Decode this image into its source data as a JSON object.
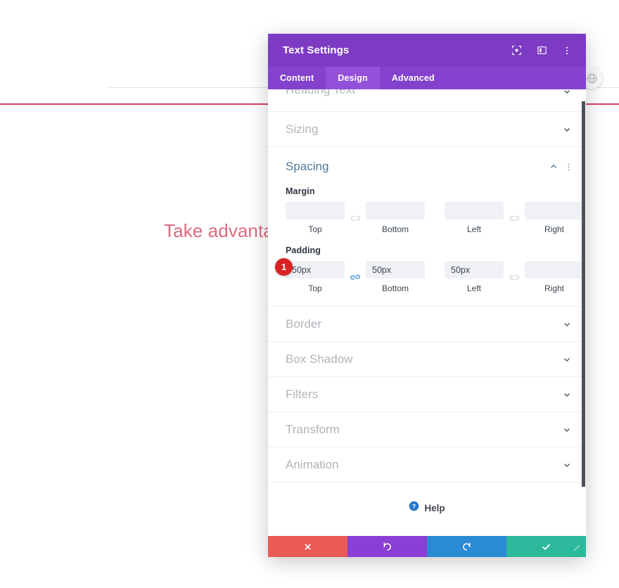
{
  "background": {
    "headline": "Take advantage",
    "headline_color": "#dd6b7f",
    "divider_gray_color": "#e2e2e6",
    "divider_red_color": "#d6405f",
    "edge_toggle_icon": "globe-disabled-icon"
  },
  "modal": {
    "title": "Text Settings",
    "header_color": "#7d3bc4",
    "header_icons": [
      {
        "name": "focus-target-icon",
        "label": "Focus"
      },
      {
        "name": "panel-layout-icon",
        "label": "Layout"
      },
      {
        "name": "more-options-icon",
        "label": "More"
      }
    ],
    "tabs": [
      {
        "label": "Content",
        "active": false
      },
      {
        "label": "Design",
        "active": true
      },
      {
        "label": "Advanced",
        "active": false
      }
    ],
    "accordions_top": [
      {
        "label": "Heading Text",
        "state": "collapsed"
      },
      {
        "label": "Sizing",
        "state": "collapsed"
      }
    ],
    "spacing": {
      "title": "Spacing",
      "title_color": "#4e7a9c",
      "state": "expanded",
      "margin": {
        "label": "Margin",
        "link_state": "unlinked",
        "fields": [
          {
            "caption": "Top",
            "value": ""
          },
          {
            "caption": "Bottom",
            "value": ""
          },
          {
            "caption": "Left",
            "value": ""
          },
          {
            "caption": "Right",
            "value": ""
          }
        ]
      },
      "padding": {
        "label": "Padding",
        "link_state_tb": "linked",
        "link_state_lr": "unlinked",
        "badge": "1",
        "badge_color": "#d92323",
        "fields": [
          {
            "caption": "Top",
            "value": "50px"
          },
          {
            "caption": "Bottom",
            "value": "50px"
          },
          {
            "caption": "Left",
            "value": "50px"
          },
          {
            "caption": "Right",
            "value": ""
          }
        ]
      }
    },
    "accordions_bottom": [
      {
        "label": "Border",
        "state": "collapsed"
      },
      {
        "label": "Box Shadow",
        "state": "collapsed"
      },
      {
        "label": "Filters",
        "state": "collapsed"
      },
      {
        "label": "Transform",
        "state": "collapsed"
      },
      {
        "label": "Animation",
        "state": "collapsed"
      }
    ],
    "help": {
      "label": "Help",
      "icon": "question-mark-icon",
      "icon_color": "#2076c9"
    },
    "footer_buttons": [
      {
        "name": "cancel",
        "icon": "close-x-icon",
        "color": "#eb5b56"
      },
      {
        "name": "undo",
        "icon": "undo-arrow-icon",
        "color": "#8b3fd4"
      },
      {
        "name": "redo",
        "icon": "redo-arrow-icon",
        "color": "#2b8ad4"
      },
      {
        "name": "save",
        "icon": "checkmark-icon",
        "color": "#2cb99b"
      }
    ]
  }
}
